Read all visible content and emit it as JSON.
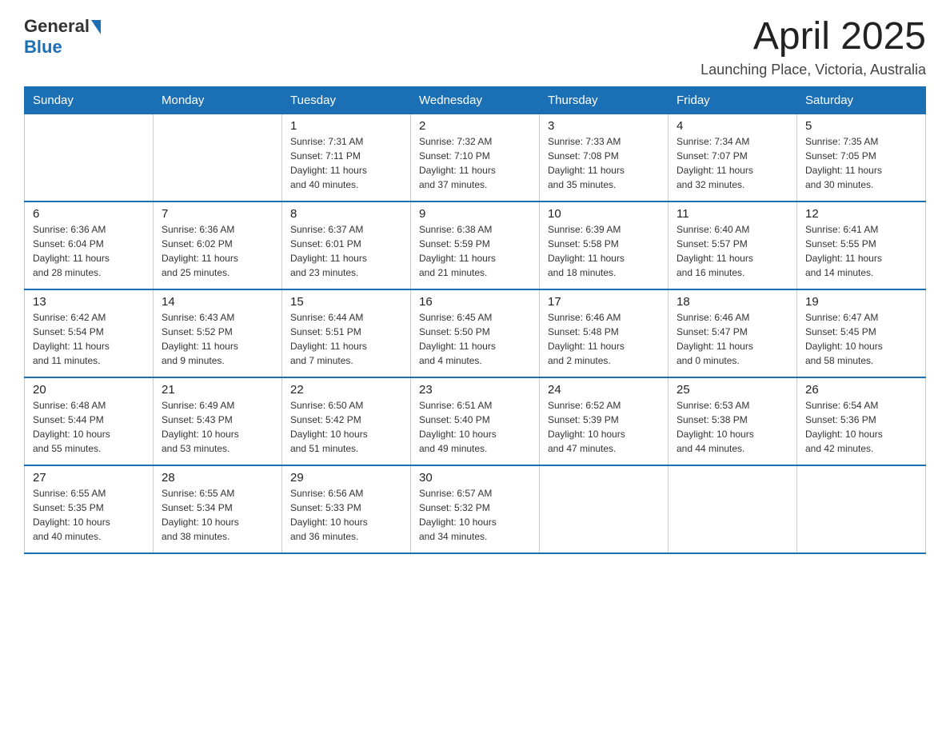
{
  "header": {
    "logo_general": "General",
    "logo_blue": "Blue",
    "month_title": "April 2025",
    "location": "Launching Place, Victoria, Australia"
  },
  "weekdays": [
    "Sunday",
    "Monday",
    "Tuesday",
    "Wednesday",
    "Thursday",
    "Friday",
    "Saturday"
  ],
  "weeks": [
    [
      {
        "day": "",
        "info": ""
      },
      {
        "day": "",
        "info": ""
      },
      {
        "day": "1",
        "info": "Sunrise: 7:31 AM\nSunset: 7:11 PM\nDaylight: 11 hours\nand 40 minutes."
      },
      {
        "day": "2",
        "info": "Sunrise: 7:32 AM\nSunset: 7:10 PM\nDaylight: 11 hours\nand 37 minutes."
      },
      {
        "day": "3",
        "info": "Sunrise: 7:33 AM\nSunset: 7:08 PM\nDaylight: 11 hours\nand 35 minutes."
      },
      {
        "day": "4",
        "info": "Sunrise: 7:34 AM\nSunset: 7:07 PM\nDaylight: 11 hours\nand 32 minutes."
      },
      {
        "day": "5",
        "info": "Sunrise: 7:35 AM\nSunset: 7:05 PM\nDaylight: 11 hours\nand 30 minutes."
      }
    ],
    [
      {
        "day": "6",
        "info": "Sunrise: 6:36 AM\nSunset: 6:04 PM\nDaylight: 11 hours\nand 28 minutes."
      },
      {
        "day": "7",
        "info": "Sunrise: 6:36 AM\nSunset: 6:02 PM\nDaylight: 11 hours\nand 25 minutes."
      },
      {
        "day": "8",
        "info": "Sunrise: 6:37 AM\nSunset: 6:01 PM\nDaylight: 11 hours\nand 23 minutes."
      },
      {
        "day": "9",
        "info": "Sunrise: 6:38 AM\nSunset: 5:59 PM\nDaylight: 11 hours\nand 21 minutes."
      },
      {
        "day": "10",
        "info": "Sunrise: 6:39 AM\nSunset: 5:58 PM\nDaylight: 11 hours\nand 18 minutes."
      },
      {
        "day": "11",
        "info": "Sunrise: 6:40 AM\nSunset: 5:57 PM\nDaylight: 11 hours\nand 16 minutes."
      },
      {
        "day": "12",
        "info": "Sunrise: 6:41 AM\nSunset: 5:55 PM\nDaylight: 11 hours\nand 14 minutes."
      }
    ],
    [
      {
        "day": "13",
        "info": "Sunrise: 6:42 AM\nSunset: 5:54 PM\nDaylight: 11 hours\nand 11 minutes."
      },
      {
        "day": "14",
        "info": "Sunrise: 6:43 AM\nSunset: 5:52 PM\nDaylight: 11 hours\nand 9 minutes."
      },
      {
        "day": "15",
        "info": "Sunrise: 6:44 AM\nSunset: 5:51 PM\nDaylight: 11 hours\nand 7 minutes."
      },
      {
        "day": "16",
        "info": "Sunrise: 6:45 AM\nSunset: 5:50 PM\nDaylight: 11 hours\nand 4 minutes."
      },
      {
        "day": "17",
        "info": "Sunrise: 6:46 AM\nSunset: 5:48 PM\nDaylight: 11 hours\nand 2 minutes."
      },
      {
        "day": "18",
        "info": "Sunrise: 6:46 AM\nSunset: 5:47 PM\nDaylight: 11 hours\nand 0 minutes."
      },
      {
        "day": "19",
        "info": "Sunrise: 6:47 AM\nSunset: 5:45 PM\nDaylight: 10 hours\nand 58 minutes."
      }
    ],
    [
      {
        "day": "20",
        "info": "Sunrise: 6:48 AM\nSunset: 5:44 PM\nDaylight: 10 hours\nand 55 minutes."
      },
      {
        "day": "21",
        "info": "Sunrise: 6:49 AM\nSunset: 5:43 PM\nDaylight: 10 hours\nand 53 minutes."
      },
      {
        "day": "22",
        "info": "Sunrise: 6:50 AM\nSunset: 5:42 PM\nDaylight: 10 hours\nand 51 minutes."
      },
      {
        "day": "23",
        "info": "Sunrise: 6:51 AM\nSunset: 5:40 PM\nDaylight: 10 hours\nand 49 minutes."
      },
      {
        "day": "24",
        "info": "Sunrise: 6:52 AM\nSunset: 5:39 PM\nDaylight: 10 hours\nand 47 minutes."
      },
      {
        "day": "25",
        "info": "Sunrise: 6:53 AM\nSunset: 5:38 PM\nDaylight: 10 hours\nand 44 minutes."
      },
      {
        "day": "26",
        "info": "Sunrise: 6:54 AM\nSunset: 5:36 PM\nDaylight: 10 hours\nand 42 minutes."
      }
    ],
    [
      {
        "day": "27",
        "info": "Sunrise: 6:55 AM\nSunset: 5:35 PM\nDaylight: 10 hours\nand 40 minutes."
      },
      {
        "day": "28",
        "info": "Sunrise: 6:55 AM\nSunset: 5:34 PM\nDaylight: 10 hours\nand 38 minutes."
      },
      {
        "day": "29",
        "info": "Sunrise: 6:56 AM\nSunset: 5:33 PM\nDaylight: 10 hours\nand 36 minutes."
      },
      {
        "day": "30",
        "info": "Sunrise: 6:57 AM\nSunset: 5:32 PM\nDaylight: 10 hours\nand 34 minutes."
      },
      {
        "day": "",
        "info": ""
      },
      {
        "day": "",
        "info": ""
      },
      {
        "day": "",
        "info": ""
      }
    ]
  ]
}
